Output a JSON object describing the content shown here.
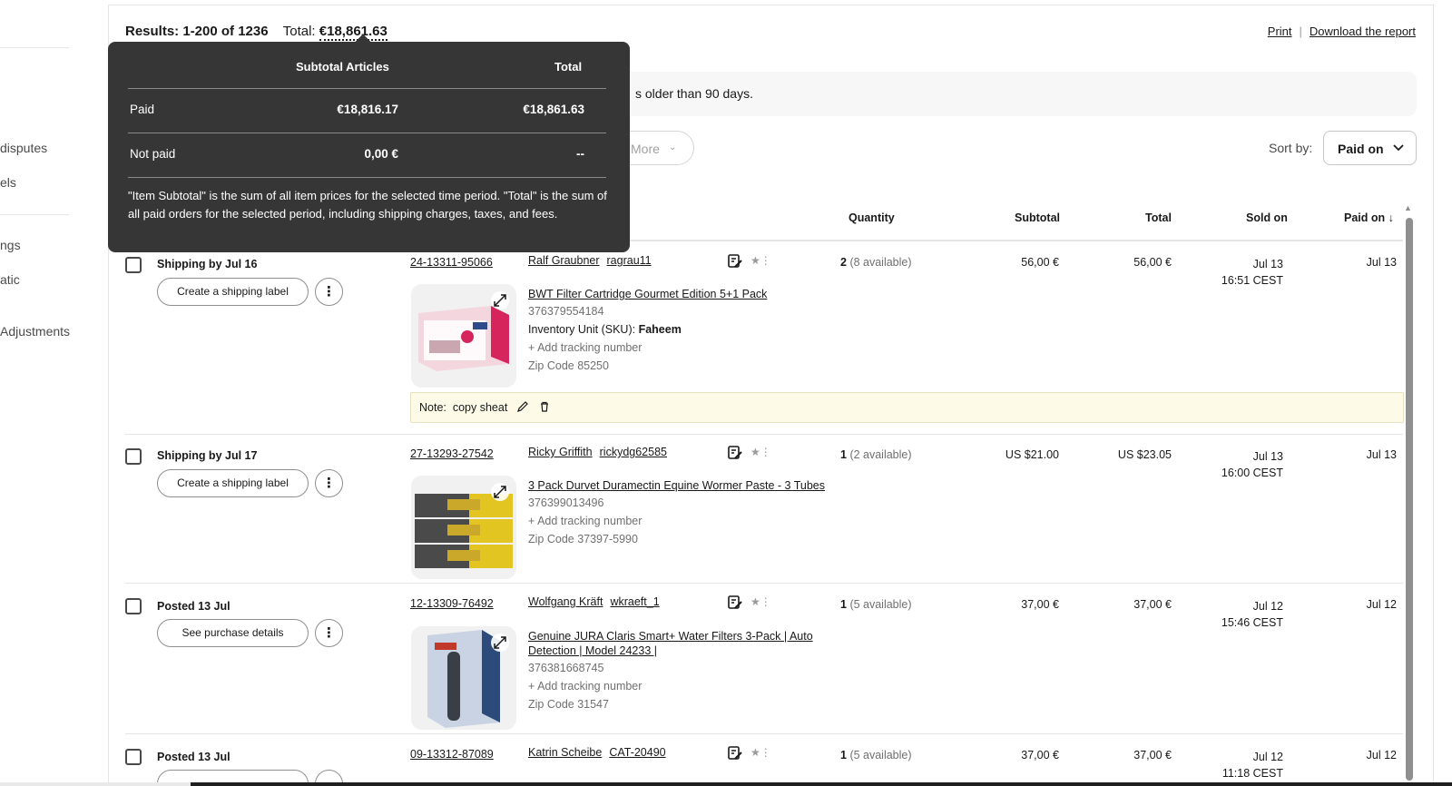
{
  "sidebar": {
    "items": [
      "disputes",
      "els",
      "ngs",
      "atic",
      "Adjustments"
    ]
  },
  "header": {
    "results": "Results: 1-200 of 1236",
    "total_label": "Total:",
    "total_value": "€18,861.63",
    "print": "Print",
    "separator": "|",
    "download": "Download the report"
  },
  "banner": {
    "text": "s older than 90 days."
  },
  "filters": {
    "more": "More"
  },
  "sort": {
    "label": "Sort by:",
    "value": "Paid on"
  },
  "columns": {
    "quantity": "Quantity",
    "subtotal": "Subtotal",
    "total": "Total",
    "sold_on": "Sold on",
    "paid_on": "Paid on"
  },
  "tooltip": {
    "col1": "Subtotal Articles",
    "col2": "Total",
    "paid_label": "Paid",
    "paid_subtotal": "€18,816.17",
    "paid_total": "€18,861.63",
    "notpaid_label": "Not paid",
    "notpaid_subtotal": "0,00 €",
    "notpaid_total": "--",
    "note": "\"Item Subtotal\" is the sum of all item prices for the selected time period. \"Total\" is the sum of all paid orders for the selected period, including shipping charges, taxes, and fees."
  },
  "orders": [
    {
      "status": "Shipping by Jul 16",
      "action": "Create a shipping label",
      "order_number": "24-13311-95066",
      "buyer_name": "Ralf Graubner",
      "buyer_id": "ragrau11",
      "qty": "2",
      "available": "(8 available)",
      "subtotal": "56,00 €",
      "total": "56,00 €",
      "sold_date": "Jul 13",
      "sold_time": "16:51 CEST",
      "paid_on": "Jul 13",
      "item_title": "BWT Filter Cartridge Gourmet Edition 5+1 Pack",
      "item_number": "376379554184",
      "sku_label": "Inventory Unit (SKU):",
      "sku_value": "Faheem",
      "tracking": "+ Add tracking number",
      "zip": "Zip Code 85250",
      "note_label": "Note:",
      "note_text": "copy sheat"
    },
    {
      "status": "Shipping by Jul 17",
      "action": "Create a shipping label",
      "order_number": "27-13293-27542",
      "buyer_name": "Ricky Griffith",
      "buyer_id": "rickydg62585",
      "qty": "1",
      "available": "(2 available)",
      "subtotal": "US $21.00",
      "total": "US $23.05",
      "sold_date": "Jul 13",
      "sold_time": "16:00 CEST",
      "paid_on": "Jul 13",
      "item_title": "3 Pack Durvet Duramectin Equine Wormer Paste - 3 Tubes",
      "item_number": "376399013496",
      "tracking": "+ Add tracking number",
      "zip": "Zip Code 37397-5990"
    },
    {
      "status": "Posted 13 Jul",
      "action": "See purchase details",
      "order_number": "12-13309-76492",
      "buyer_name": "Wolfgang Kräft",
      "buyer_id": "wkraeft_1",
      "qty": "1",
      "available": "(5 available)",
      "subtotal": "37,00 €",
      "total": "37,00 €",
      "sold_date": "Jul 12",
      "sold_time": "15:46 CEST",
      "paid_on": "Jul 12",
      "item_title": "Genuine JURA Claris Smart+ Water Filters 3-Pack | Auto Detection | Model 24233 |",
      "item_number": "376381668745",
      "tracking": "+ Add tracking number",
      "zip": "Zip Code 31547"
    },
    {
      "status": "Posted 13 Jul",
      "order_number": "09-13312-87089",
      "buyer_name": "Katrin Scheibe",
      "buyer_id": "CAT-20490",
      "qty": "1",
      "available": "(5 available)",
      "subtotal": "37,00 €",
      "total": "37,00 €",
      "sold_date": "Jul 12",
      "sold_time": "11:18 CEST",
      "paid_on": "Jul 12"
    }
  ],
  "colors": {
    "tooltip_bg": "#363636",
    "note_bg": "#fdfbe8",
    "text": "#191919",
    "muted": "#707070"
  }
}
